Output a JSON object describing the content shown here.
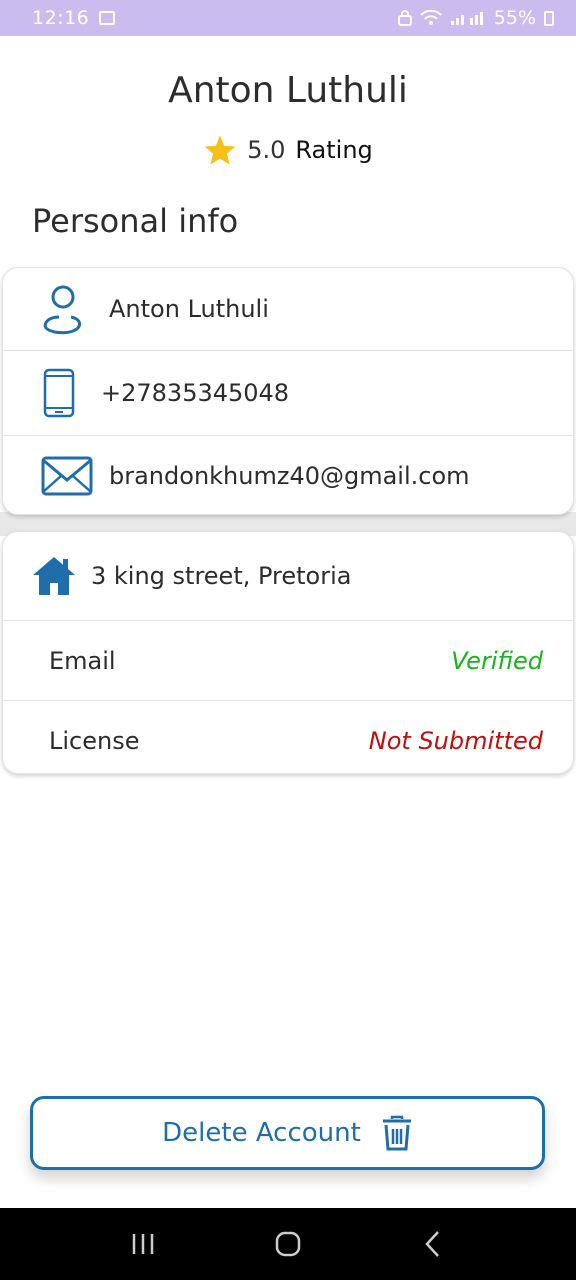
{
  "status_bar": {
    "time": "12:16",
    "battery": "55%"
  },
  "profile": {
    "name": "Anton Luthuli",
    "rating_value": "5.0",
    "rating_label": "Rating"
  },
  "personal_info": {
    "title": "Personal info",
    "name": "Anton Luthuli",
    "phone": "+27835345048",
    "email": "brandonkhumz40@gmail.com"
  },
  "address_card": {
    "address": "3 king street, Pretoria",
    "email_label": "Email",
    "email_status": "Verified",
    "license_label": "License",
    "license_status": "Not Submitted"
  },
  "actions": {
    "delete_label": "Delete Account"
  },
  "colors": {
    "accent": "#1f6eab",
    "verified": "#18b41b",
    "not_submitted": "#c30c0c",
    "star": "#f5c018",
    "status_bar": "#cbbcf0"
  },
  "icons": {
    "person": "person-icon",
    "phone": "phone-icon",
    "mail": "mail-icon",
    "home": "home-icon",
    "star": "star-icon",
    "trash": "trash-icon"
  }
}
